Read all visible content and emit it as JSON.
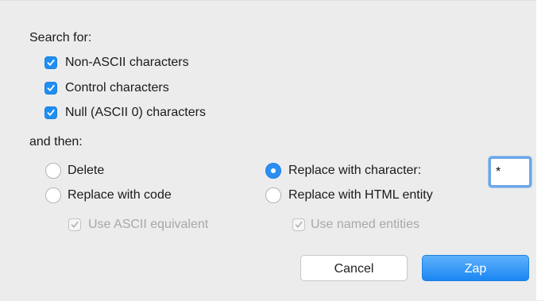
{
  "dialog": {
    "search_heading": "Search for:",
    "search_options": [
      {
        "label": "Non-ASCII characters",
        "checked": true
      },
      {
        "label": "Control characters",
        "checked": true
      },
      {
        "label": "Null (ASCII 0) characters",
        "checked": true
      }
    ],
    "then_heading": "and then:",
    "actions": {
      "delete": {
        "label": "Delete",
        "selected": false
      },
      "replace_with_code": {
        "label": "Replace with code",
        "selected": false
      },
      "use_ascii_equivalent": {
        "label": "Use ASCII equivalent",
        "checked": true,
        "enabled": false
      },
      "replace_with_character": {
        "label": "Replace with character:",
        "selected": true
      },
      "replacement_character": "*",
      "replace_with_html_entity": {
        "label": "Replace with HTML entity",
        "selected": false
      },
      "use_named_entities": {
        "label": "Use named entities",
        "checked": true,
        "enabled": false
      }
    },
    "buttons": {
      "cancel": "Cancel",
      "zap": "Zap"
    }
  },
  "colors": {
    "accent": "#1f8ef1",
    "background": "#ececec",
    "disabled_text": "#a8a8a8"
  }
}
